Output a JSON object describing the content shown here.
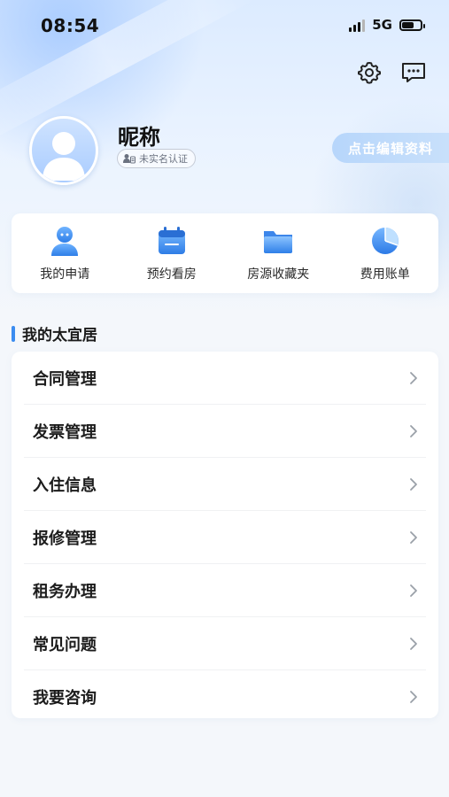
{
  "status_bar": {
    "time": "08:54",
    "network": "5G",
    "signal_bars": 4,
    "signal_level": 3,
    "battery_level": 0.65
  },
  "header": {
    "settings_icon": "gear-icon",
    "message_icon": "message-icon"
  },
  "profile": {
    "nickname": "昵称",
    "verify_status": "未实名认证",
    "edit_button": "点击编辑资料"
  },
  "quick_actions": [
    {
      "label": "我的申请",
      "icon": "application-icon"
    },
    {
      "label": "预约看房",
      "icon": "calendar-icon"
    },
    {
      "label": "房源收藏夹",
      "icon": "folder-icon"
    },
    {
      "label": "费用账单",
      "icon": "pie-chart-icon"
    }
  ],
  "section": {
    "title": "我的太宜居"
  },
  "menu": [
    {
      "label": "合同管理"
    },
    {
      "label": "发票管理"
    },
    {
      "label": "入住信息"
    },
    {
      "label": "报修管理"
    },
    {
      "label": "租务办理"
    },
    {
      "label": "常见问题"
    },
    {
      "label": "我要咨询"
    }
  ],
  "colors": {
    "accent": "#3b8cf0",
    "edit_button_bg": "#c2dcfb",
    "page_bg": "#f4f7fb"
  }
}
